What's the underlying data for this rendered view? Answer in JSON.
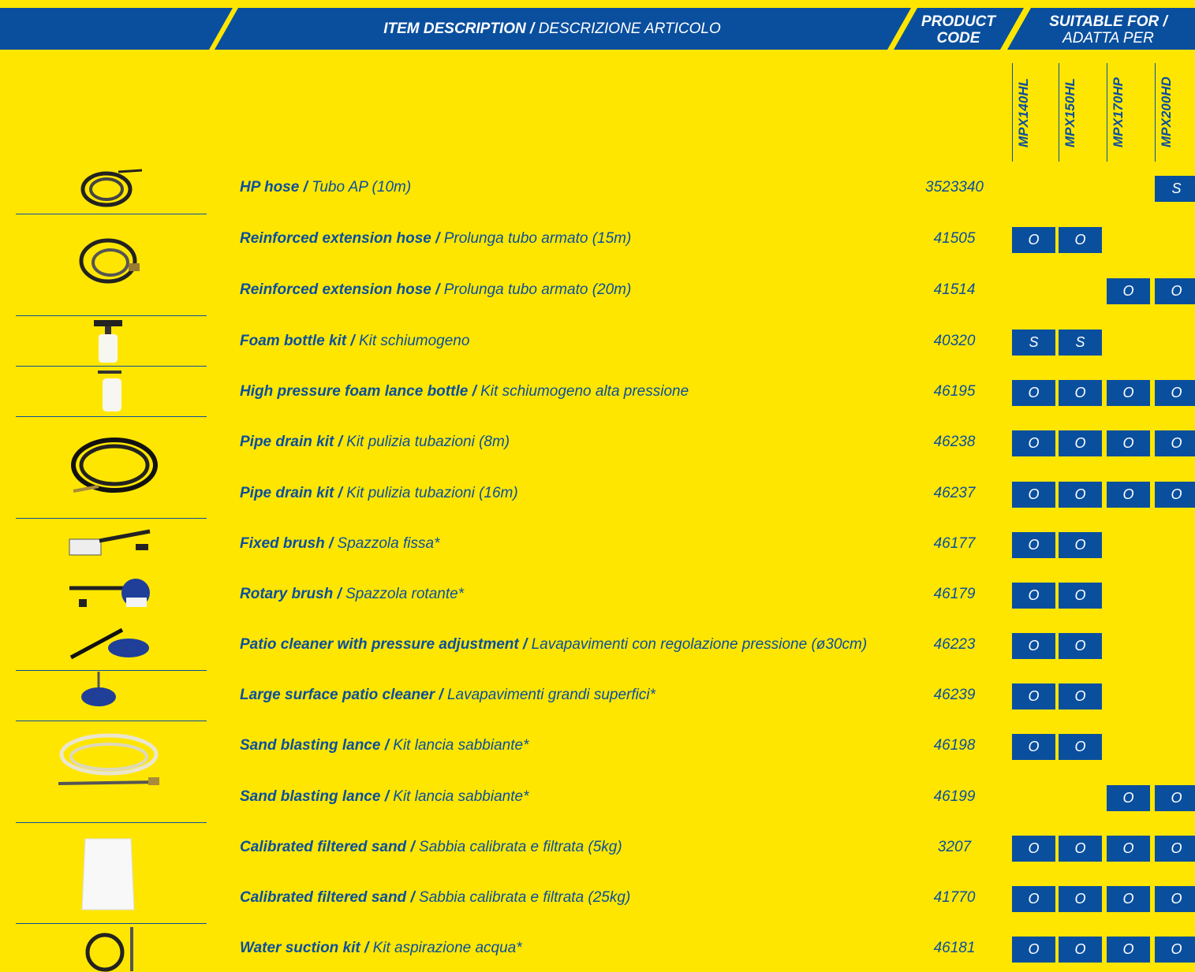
{
  "header": {
    "item_bold": "ITEM DESCRIPTION /",
    "item_plain": "DESCRIZIONE ARTICOLO",
    "code_line1": "PRODUCT",
    "code_line2": "CODE",
    "suit_bold": "SUITABLE FOR /",
    "suit_plain": "ADATTA PER"
  },
  "models": [
    "MPX140HL",
    "MPX150HL",
    "MPX170HP",
    "MPX200HD"
  ],
  "colors": {
    "blue": "#0a4f9e",
    "yellow": "#ffe600"
  },
  "rows": [
    {
      "name_en": "HP hose /",
      "name_it": "Tubo AP (10m)",
      "code": "3523340",
      "marks": [
        "",
        "",
        "",
        "S"
      ]
    },
    {
      "name_en": "Reinforced extension hose /",
      "name_it": "Prolunga tubo armato (15m)",
      "code": "41505",
      "marks": [
        "O",
        "O",
        "",
        ""
      ]
    },
    {
      "name_en": "Reinforced extension hose /",
      "name_it": "Prolunga tubo armato (20m)",
      "code": "41514",
      "marks": [
        "",
        "",
        "O",
        "O"
      ]
    },
    {
      "name_en": "Foam bottle kit /",
      "name_it": "Kit schiumogeno",
      "code": "40320",
      "marks": [
        "S",
        "S",
        "",
        ""
      ]
    },
    {
      "name_en": "High pressure foam lance bottle /",
      "name_it": "Kit schiumogeno alta pressione",
      "code": "46195",
      "marks": [
        "O",
        "O",
        "O",
        "O"
      ]
    },
    {
      "name_en": "Pipe drain kit /",
      "name_it": "Kit pulizia tubazioni (8m)",
      "code": "46238",
      "marks": [
        "O",
        "O",
        "O",
        "O"
      ]
    },
    {
      "name_en": "Pipe drain kit /",
      "name_it": "Kit pulizia tubazioni (16m)",
      "code": "46237",
      "marks": [
        "O",
        "O",
        "O",
        "O"
      ]
    },
    {
      "name_en": "Fixed brush /",
      "name_it": "Spazzola fissa*",
      "code": "46177",
      "marks": [
        "O",
        "O",
        "",
        ""
      ]
    },
    {
      "name_en": "Rotary brush /",
      "name_it": "Spazzola rotante*",
      "code": "46179",
      "marks": [
        "O",
        "O",
        "",
        ""
      ]
    },
    {
      "name_en": "Patio cleaner with pressure adjustment /",
      "name_it": "Lavapavimenti con regolazione pressione (ø30cm)",
      "code": "46223",
      "marks": [
        "O",
        "O",
        "",
        ""
      ]
    },
    {
      "name_en": "Large surface patio cleaner /",
      "name_it": "Lavapavimenti grandi superfici*",
      "code": "46239",
      "marks": [
        "O",
        "O",
        "",
        ""
      ]
    },
    {
      "name_en": "Sand blasting lance /",
      "name_it": "Kit lancia sabbiante*",
      "code": "46198",
      "marks": [
        "O",
        "O",
        "",
        ""
      ]
    },
    {
      "name_en": "Sand blasting lance /",
      "name_it": "Kit lancia sabbiante*",
      "code": "46199",
      "marks": [
        "",
        "",
        "O",
        "O"
      ]
    },
    {
      "name_en": "Calibrated filtered sand /",
      "name_it": "Sabbia calibrata e filtrata (5kg)",
      "code": "3207",
      "marks": [
        "O",
        "O",
        "O",
        "O"
      ]
    },
    {
      "name_en": "Calibrated filtered sand /",
      "name_it": "Sabbia calibrata e filtrata (25kg)",
      "code": "41770",
      "marks": [
        "O",
        "O",
        "O",
        "O"
      ]
    },
    {
      "name_en": "Water suction kit /",
      "name_it": "Kit aspirazione acqua*",
      "code": "46181",
      "marks": [
        "O",
        "O",
        "O",
        "O"
      ]
    }
  ]
}
